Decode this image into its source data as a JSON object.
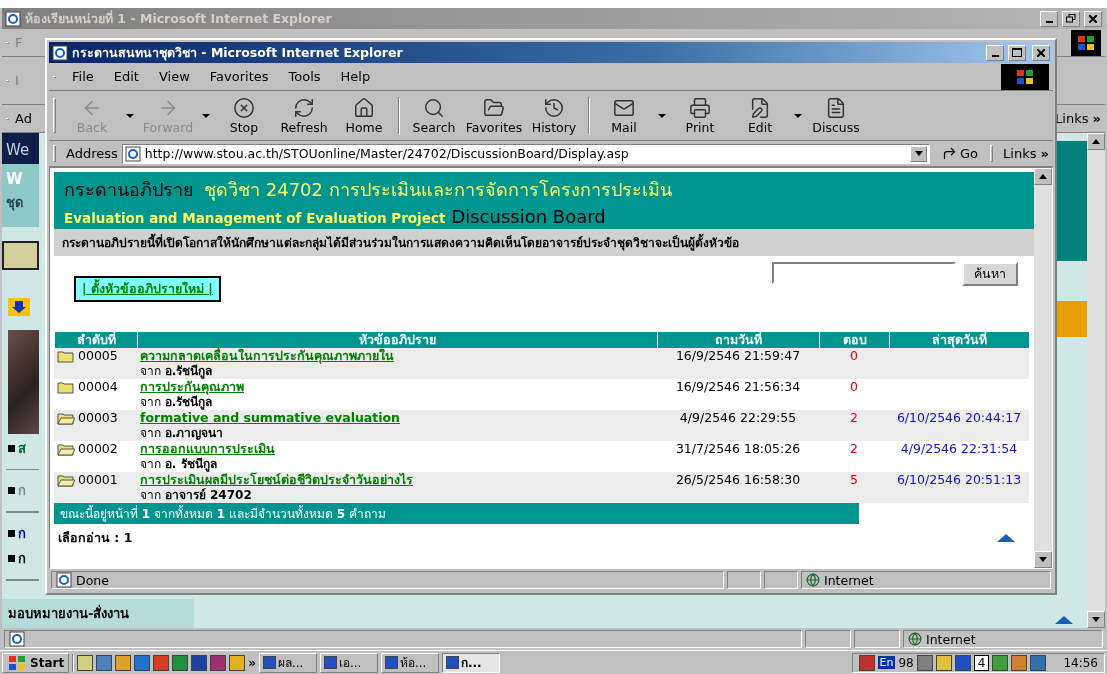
{
  "outer_window": {
    "title": "ห้องเรียนหน่วยที่ 1 - Microsoft Internet Explorer",
    "menu_partial": "F",
    "toolbar_partial": "I",
    "address_partial": "Ad",
    "links": "Links",
    "links_more": "»",
    "sidebar": [
      {
        "kind": "banner",
        "text": "We"
      },
      {
        "kind": "heading",
        "text": "W"
      },
      {
        "kind": "subheading",
        "text": "ชุด"
      },
      {
        "kind": "block"
      },
      {
        "kind": "arrow"
      },
      {
        "kind": "photo"
      },
      {
        "kind": "bullet",
        "text": "ส",
        "color": "#006633"
      },
      {
        "kind": "rule"
      },
      {
        "kind": "bullet",
        "text": "ก",
        "color": "#888888"
      },
      {
        "kind": "rule"
      },
      {
        "kind": "bullet",
        "text": "ก",
        "color": "#0000cc"
      },
      {
        "kind": "bullet",
        "text": "ก",
        "color": "#000000"
      },
      {
        "kind": "rule"
      },
      {
        "kind": "wide",
        "text": "มอบหมายงาน-สั่งงาน",
        "color": "#000000"
      }
    ],
    "status_zone": "Internet"
  },
  "inner_window": {
    "title": "กระดานสนทนาชุดวิชา - Microsoft Internet Explorer",
    "menu": [
      "File",
      "Edit",
      "View",
      "Favorites",
      "Tools",
      "Help"
    ],
    "toolbar": [
      {
        "label": "Back",
        "disabled": true,
        "dropdown": true
      },
      {
        "label": "Forward",
        "disabled": true,
        "dropdown": true
      },
      {
        "label": "Stop",
        "disabled": false,
        "dropdown": false
      },
      {
        "label": "Refresh",
        "disabled": false,
        "dropdown": false
      },
      {
        "label": "Home",
        "disabled": false,
        "dropdown": false
      },
      {
        "label": "Search",
        "disabled": false,
        "dropdown": false
      },
      {
        "label": "Favorites",
        "disabled": false,
        "dropdown": false
      },
      {
        "label": "History",
        "disabled": false,
        "dropdown": false
      },
      {
        "label": "Mail",
        "disabled": false,
        "dropdown": true
      },
      {
        "label": "Print",
        "disabled": false,
        "dropdown": false
      },
      {
        "label": "Edit",
        "disabled": false,
        "dropdown": true
      },
      {
        "label": "Discuss",
        "disabled": false,
        "dropdown": false
      }
    ],
    "address": {
      "label": "Address",
      "url": "http://www.stou.ac.th/STOUonline/Master/24702/DiscussionBoard/Display.asp",
      "go": "Go",
      "links": "Links",
      "links_more": "»"
    },
    "page": {
      "title": "กระดานอภิปราย",
      "course": "ชุดวิชา 24702 การประเมินและการจัดการโครงการประเมิน",
      "subtitle": "Evaluation and Management of Evaluation Project",
      "board": "Discussion Board",
      "description": "กระดานอภิปรายนี้ที่เปิดโอกาสให้นักศึกษาแต่ละกลุ่มได้มีส่วนร่วมในการแสดงความคิดเห็นโดยอาจารย์ประจำชุดวิชาจะเป็นผู้ตั้งหัวข้อ",
      "new_topic": "| ตั้งหัวข้ออภิปรายใหม่ |",
      "search_button": "ค้นหา",
      "columns": [
        "ลำดับที่",
        "หัวข้ออภิปราย",
        "ถามวันที่",
        "ตอบ",
        "ล่าสุดวันที่"
      ],
      "rows": [
        {
          "id": "00005",
          "topic": "ความกลาดเคลื่อนในการประกันคุณภาพภายใน",
          "author": "จาก **อ.รัชนีกูล**",
          "asked": "16/9/2546 21:59:47",
          "replies": "0",
          "opened": false
        },
        {
          "id": "00004",
          "topic": "การประกันคุณภาพ",
          "author": "จาก **อ.รัชนีกูล**",
          "asked": "16/9/2546 21:56:34",
          "replies": "0",
          "opened": false
        },
        {
          "id": "00003",
          "topic": "formative and summative evaluation",
          "author": "จาก **อ.ภาญจนา**",
          "asked": "4/9/2546 22:29:55",
          "replies": "2",
          "latest": "6/10/2546 20:44:17",
          "opened": true
        },
        {
          "id": "00002",
          "topic": "การออกแบบการประเมิน",
          "author": "จาก **อ. รัชนีกูล**",
          "asked": "31/7/2546 18:05:26",
          "replies": "2",
          "latest": "4/9/2546 22:31:54",
          "opened": true
        },
        {
          "id": "00001",
          "topic": "การประเมินผลมีประโยชน์ต่อชีวิตประจำวันอย่างไร",
          "author": "จาก **อาจารย์ 24702**",
          "asked": "26/5/2546 16:58:30",
          "replies": "5",
          "latest": "6/10/2546 20:51:13",
          "opened": true
        }
      ],
      "footer": "ขณะนี้อยู่หน้าที่ **1** จากทั้งหมด **1** และมีจำนวนทั้งหมด **5** คำถาม",
      "pages": "เลือกอ่าน : 1"
    },
    "status": "Done",
    "status_zone": "Internet"
  },
  "taskbar": {
    "start": "Start",
    "more": "»",
    "tasks": [
      {
        "label": "ผล...",
        "selected": false
      },
      {
        "label": "เอ...",
        "selected": false
      },
      {
        "label": "ห้อ...",
        "selected": false
      },
      {
        "label": "ก...",
        "selected": true
      }
    ],
    "lang": "En",
    "tray_text": "98",
    "tray_badge": "4",
    "clock": "14:56"
  }
}
